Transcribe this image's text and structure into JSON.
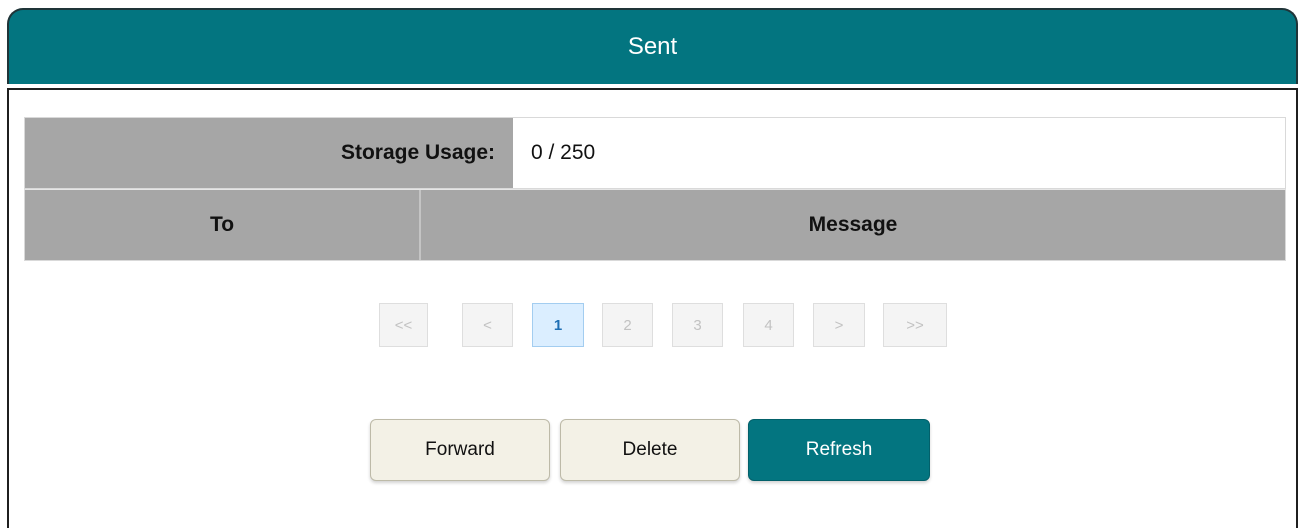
{
  "header": {
    "title": "Sent"
  },
  "storage": {
    "label": "Storage Usage:",
    "value": "0 / 250"
  },
  "table": {
    "columns": [
      "To",
      "Message"
    ]
  },
  "pagination": {
    "items": [
      "<<",
      "<",
      "1",
      "2",
      "3",
      "4",
      ">",
      ">>"
    ],
    "current": "1"
  },
  "actions": {
    "forward_label": "Forward",
    "delete_label": "Delete",
    "refresh_label": "Refresh"
  },
  "colors": {
    "accent": "#037580",
    "header_gray": "#a6a6a6",
    "button_light": "#f3f1e6",
    "page_active_bg": "#dbeeff"
  }
}
